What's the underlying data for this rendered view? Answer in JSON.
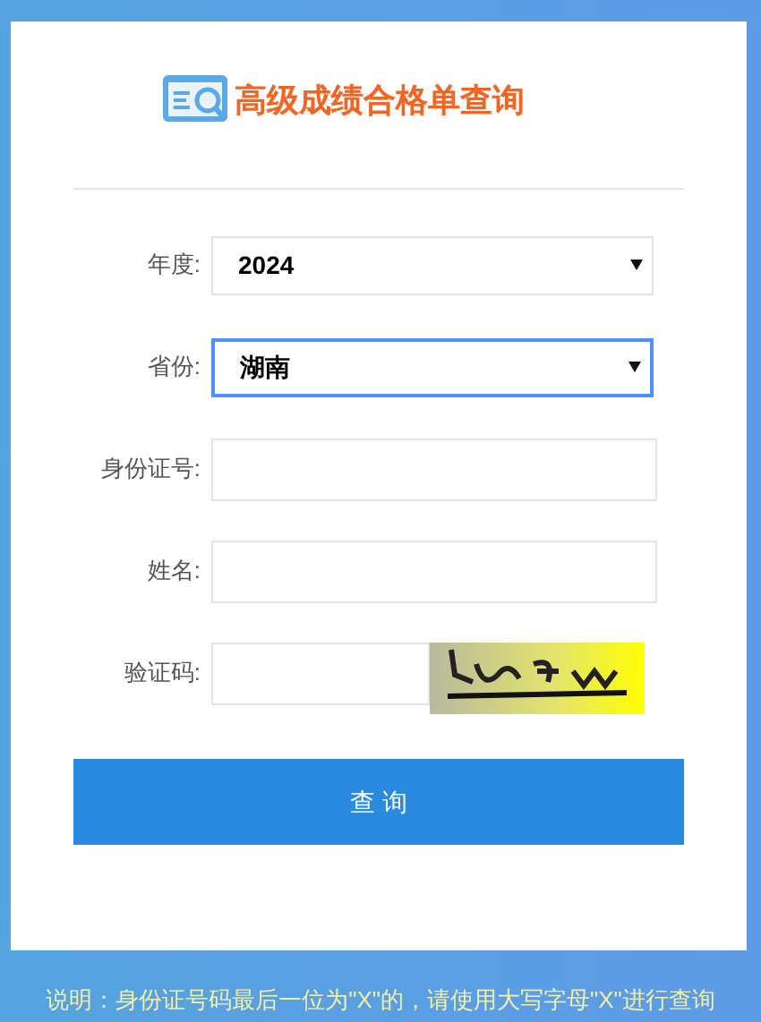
{
  "header": {
    "title": "高级成绩合格单查询"
  },
  "fields": [
    {
      "kind": "select",
      "label": "年度:",
      "value": "2024",
      "focused": false
    },
    {
      "kind": "select",
      "label": "省份:",
      "value": "湖南",
      "focused": true
    },
    {
      "kind": "input",
      "label": "身份证号:",
      "focused": false
    },
    {
      "kind": "input",
      "label": "姓名:",
      "focused": false
    },
    {
      "kind": "captcha",
      "label": "验证码:",
      "focused": false
    }
  ],
  "submit": {
    "label": "查 询"
  },
  "note": "说明：身份证号码最后一位为\"X\"的，请使用大写字母\"X\"进行查询"
}
